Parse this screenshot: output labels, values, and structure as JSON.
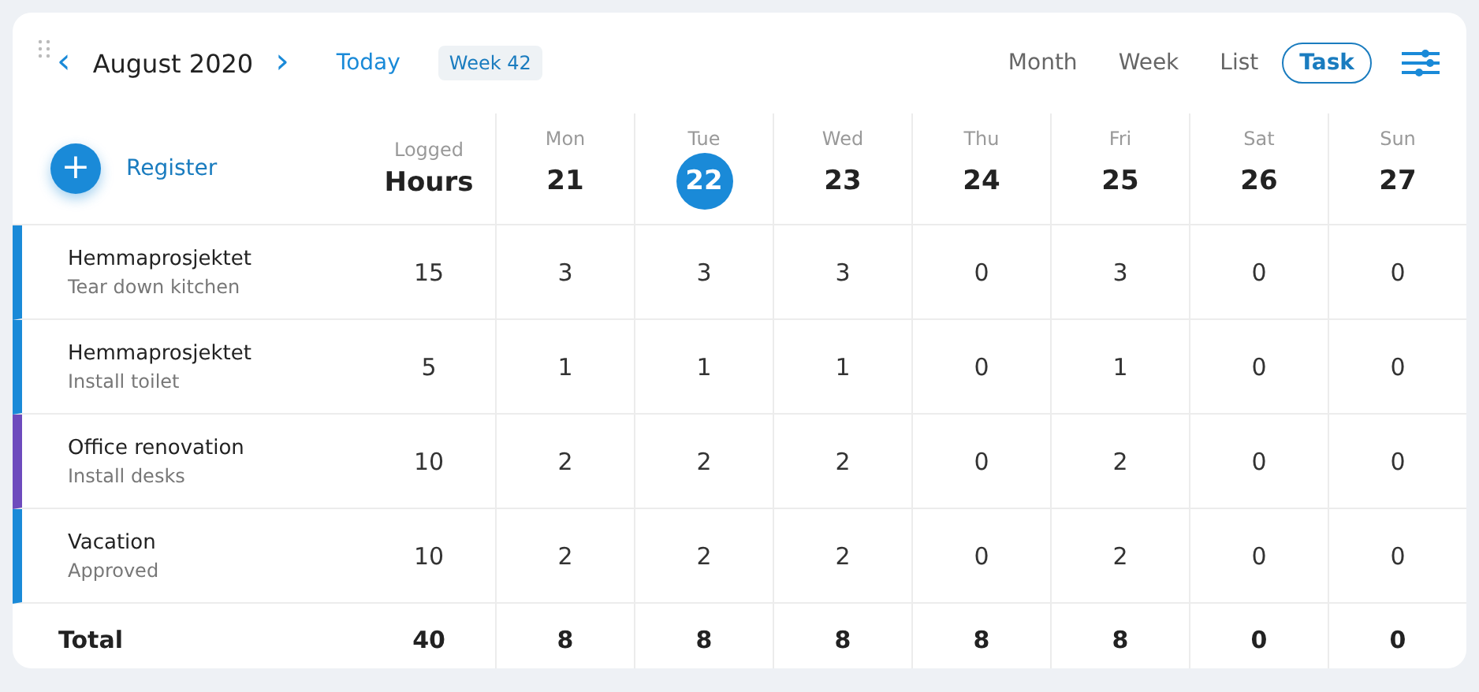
{
  "toolbar": {
    "prev": "‹",
    "month": "August 2020",
    "next": "›",
    "today": "Today",
    "week": "Week 42"
  },
  "views": [
    {
      "label": "Month",
      "selected": false
    },
    {
      "label": "Week",
      "selected": false
    },
    {
      "label": "List",
      "selected": false
    },
    {
      "label": "Task",
      "selected": true
    }
  ],
  "register": {
    "icon": "+",
    "label": "Register"
  },
  "logged": {
    "caption": "Logged",
    "label": "Hours"
  },
  "days": [
    {
      "weekday": "Mon",
      "date": "21",
      "selected": false
    },
    {
      "weekday": "Tue",
      "date": "22",
      "selected": true
    },
    {
      "weekday": "Wed",
      "date": "23",
      "selected": false
    },
    {
      "weekday": "Thu",
      "date": "24",
      "selected": false
    },
    {
      "weekday": "Fri",
      "date": "25",
      "selected": false
    },
    {
      "weekday": "Sat",
      "date": "26",
      "selected": false
    },
    {
      "weekday": "Sun",
      "date": "27",
      "selected": false
    }
  ],
  "rows": [
    {
      "title": "Hemmaprosjektet",
      "subtitle": "Tear down kitchen",
      "color": "#1a8ad8",
      "logged": "15",
      "hours": [
        "3",
        "3",
        "3",
        "0",
        "3",
        "0",
        "0"
      ]
    },
    {
      "title": "Hemmaprosjektet",
      "subtitle": "Install toilet",
      "color": "#1a8ad8",
      "logged": "5",
      "hours": [
        "1",
        "1",
        "1",
        "0",
        "1",
        "0",
        "0"
      ]
    },
    {
      "title": "Office renovation",
      "subtitle": "Install desks",
      "color": "#6e4bbd",
      "logged": "10",
      "hours": [
        "2",
        "2",
        "2",
        "0",
        "2",
        "0",
        "0"
      ]
    },
    {
      "title": "Vacation",
      "subtitle": "Approved",
      "color": "#1a8ad8",
      "logged": "10",
      "hours": [
        "2",
        "2",
        "2",
        "0",
        "2",
        "0",
        "0"
      ]
    }
  ],
  "total": {
    "label": "Total",
    "logged": "40",
    "hours": [
      "8",
      "8",
      "8",
      "8",
      "8",
      "0",
      "0"
    ]
  }
}
